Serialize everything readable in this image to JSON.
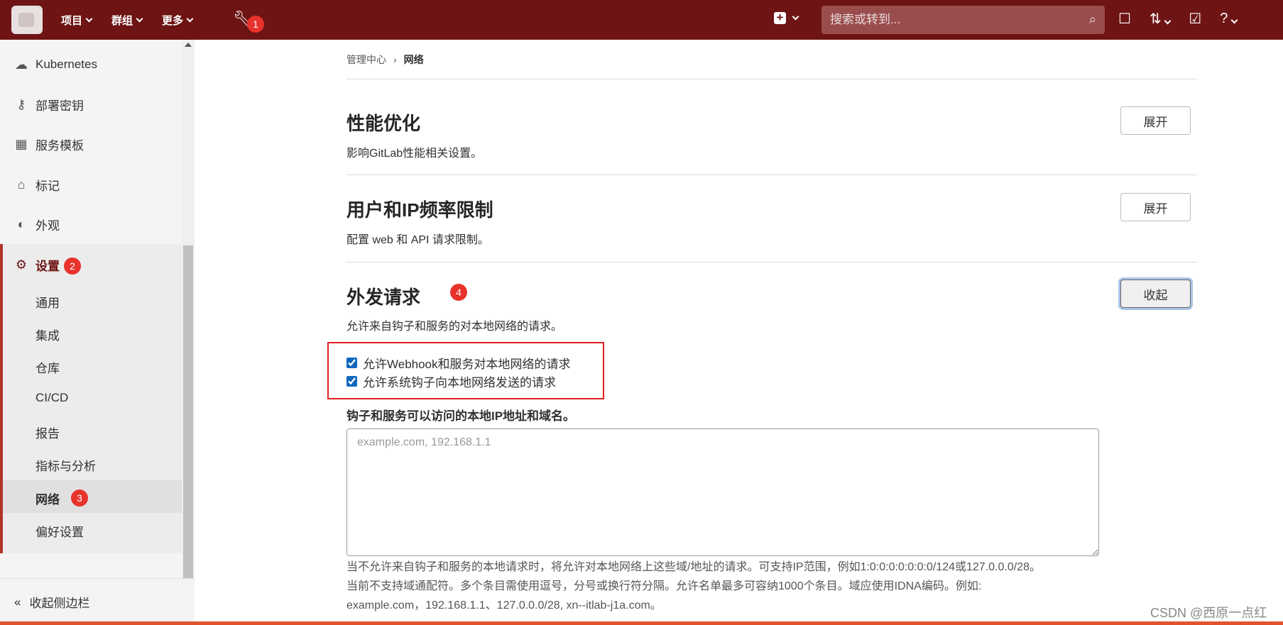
{
  "topbar": {
    "menu": [
      "项目",
      "群组",
      "更多"
    ],
    "wrench_badge": "1",
    "search_placeholder": "搜索或转到..."
  },
  "sidebar": {
    "items": [
      {
        "label": "Kubernetes",
        "icon": "cloud-icon"
      },
      {
        "label": "部署密钥",
        "icon": "key-icon"
      },
      {
        "label": "服务模板",
        "icon": "template-icon"
      },
      {
        "label": "标记",
        "icon": "tag-icon"
      },
      {
        "label": "外观",
        "icon": "palette-icon"
      }
    ],
    "settings_label": "设置",
    "settings_badge": "2",
    "sub_items": [
      "通用",
      "集成",
      "仓库",
      "CI/CD",
      "报告",
      "指标与分析",
      "网络",
      "偏好设置"
    ],
    "network_badge": "3",
    "collapse_label": "收起侧边栏"
  },
  "breadcrumb": {
    "parent": "管理中心",
    "current": "网络"
  },
  "sections": {
    "perf": {
      "title": "性能优化",
      "desc": "影响GitLab性能相关设置。",
      "button": "展开"
    },
    "rate": {
      "title": "用户和IP频率限制",
      "desc": "配置 web 和 API 请求限制。",
      "button": "展开"
    },
    "outbound": {
      "title": "外发请求",
      "badge": "4",
      "desc": "允许来自钩子和服务的对本地网络的请求。",
      "button": "收起",
      "check1": "允许Webhook和服务对本地网络的请求",
      "check2": "允许系统钩子向本地网络发送的请求",
      "field_label": "钩子和服务可以访问的本地IP地址和域名。",
      "placeholder": "example.com, 192.168.1.1",
      "help1": "当不允许来自钩子和服务的本地请求时，将允许对本地网络上这些域/地址的请求。可支持IP范围，例如1:0:0:0:0:0:0:0/124或127.0.0.0/28。",
      "help2": "当前不支持域通配符。多个条目需使用逗号，分号或换行符分隔。允许名单最多可容纳1000个条目。域应使用IDNA编码。例如:",
      "help3": "example.com，192.168.1.1、127.0.0.0/28, xn--itlab-j1a.com。"
    }
  },
  "watermark": "CSDN @西原一点红",
  "colors": {
    "topbar": "#6e1414",
    "accent": "#b0332b",
    "badge": "#e8322c",
    "annotation": "#e02020"
  }
}
